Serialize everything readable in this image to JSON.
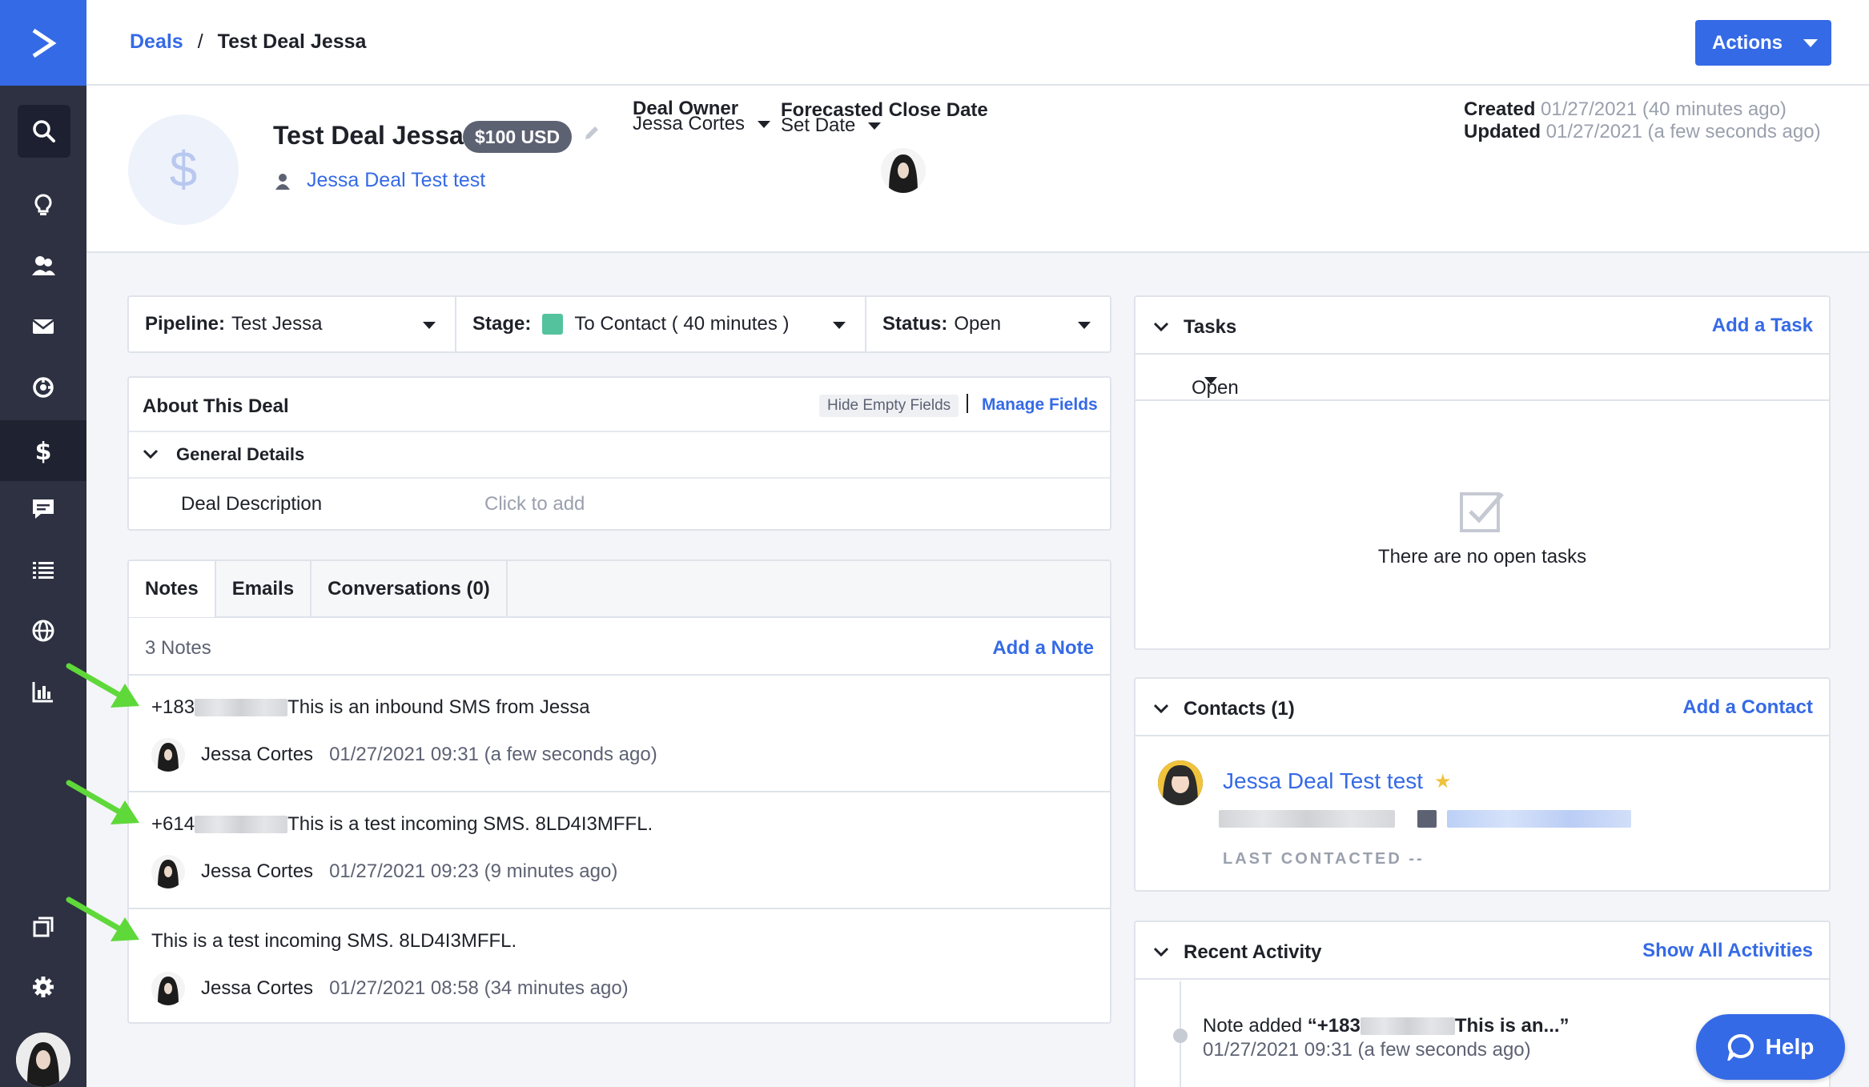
{
  "breadcrumb": {
    "parent": "Deals",
    "separator": "/",
    "current": "Test Deal Jessa"
  },
  "toolbar": {
    "actions_label": "Actions"
  },
  "deal": {
    "title": "Test Deal Jessa",
    "value_badge": "$100 USD",
    "contact_link": "Jessa Deal Test test",
    "owner_label": "Deal Owner",
    "owner_value": "Jessa Cortes",
    "close_date_label": "Forecasted Close Date",
    "close_date_value": "Set Date",
    "created_label": "Created",
    "created_value": "01/27/2021 (40 minutes ago)",
    "updated_label": "Updated",
    "updated_value": "01/27/2021 (a few seconds ago)"
  },
  "pipeline_bar": {
    "pipeline_label": "Pipeline:",
    "pipeline_value": "Test Jessa",
    "stage_label": "Stage:",
    "stage_value": "To Contact ( 40 minutes )",
    "stage_color": "#54c39d",
    "status_label": "Status:",
    "status_value": "Open"
  },
  "about": {
    "title": "About This Deal",
    "hide_empty": "Hide Empty Fields",
    "manage_fields": "Manage Fields",
    "section": "General Details",
    "field_label": "Deal Description",
    "field_placeholder": "Click to add"
  },
  "notes": {
    "tabs": [
      "Notes",
      "Emails",
      "Conversations (0)"
    ],
    "count": "3 Notes",
    "add_label": "Add a Note",
    "items": [
      {
        "prefix": "+183",
        "text": "This is an inbound SMS from Jessa",
        "author": "Jessa Cortes",
        "date": "01/27/2021 09:31 (a few seconds ago)"
      },
      {
        "prefix": "+614",
        "text": "This is a test incoming SMS. 8LD4I3MFFL.",
        "author": "Jessa Cortes",
        "date": "01/27/2021 09:23 (9 minutes ago)"
      },
      {
        "prefix": "",
        "text": "This is a test incoming SMS. 8LD4I3MFFL.",
        "author": "Jessa Cortes",
        "date": "01/27/2021 08:58 (34 minutes ago)"
      }
    ]
  },
  "tasks": {
    "title": "Tasks",
    "add_label": "Add a Task",
    "filter": "Open",
    "empty_message": "There are no open tasks"
  },
  "contacts": {
    "title": "Contacts (1)",
    "add_label": "Add a Contact",
    "name": "Jessa Deal Test test",
    "last_contacted": "LAST CONTACTED --"
  },
  "recent_activity": {
    "title": "Recent Activity",
    "show_all": "Show All Activities",
    "item_prefix": "Note added ",
    "item_quote_open": "“+183",
    "item_quote_close": "This is an...”",
    "item_date": "01/27/2021 09:31 (a few seconds ago)"
  },
  "help": {
    "label": "Help"
  },
  "colors": {
    "brand": "#356ae6",
    "nav": "#2d3141",
    "annotation_arrow": "#5fd83a"
  }
}
